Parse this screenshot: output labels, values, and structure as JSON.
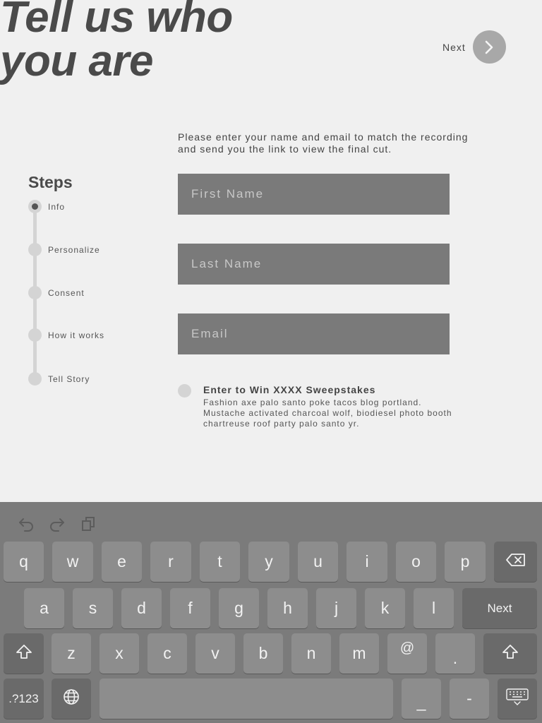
{
  "header": {
    "title_line1": "Tell us who",
    "title_line2": "you are",
    "next_label": "Next"
  },
  "steps": {
    "title": "Steps",
    "items": [
      {
        "label": "Info",
        "active": true
      },
      {
        "label": "Personalize",
        "active": false
      },
      {
        "label": "Consent",
        "active": false
      },
      {
        "label": "How it works",
        "active": false
      },
      {
        "label": "Tell Story",
        "active": false
      }
    ]
  },
  "form": {
    "instructions": "Please enter your name and email to match the recording and send you the link to view the final cut.",
    "first_name_placeholder": "First Name",
    "last_name_placeholder": "Last Name",
    "email_placeholder": "Email",
    "sweepstakes_title": "Enter to Win XXXX Sweepstakes",
    "sweepstakes_desc": "Fashion axe palo santo poke tacos blog portland. Mustache activated charcoal wolf, biodiesel photo booth chartreuse roof party palo santo yr."
  },
  "keyboard": {
    "row1": [
      "q",
      "w",
      "e",
      "r",
      "t",
      "y",
      "u",
      "i",
      "o",
      "p"
    ],
    "row2": [
      "a",
      "s",
      "d",
      "f",
      "g",
      "h",
      "j",
      "k",
      "l"
    ],
    "row2_action": "Next",
    "row3": [
      "z",
      "x",
      "c",
      "v",
      "b",
      "n",
      "m",
      "@",
      "."
    ],
    "mode_key": ".?123",
    "underscore": "_",
    "dash": "-"
  },
  "colors": {
    "background": "#f0f0f0",
    "field": "#7a7a7a",
    "keyboard": "#7b7b7b",
    "key": "#8d8d8d",
    "key_dark": "#6a6a6a"
  }
}
